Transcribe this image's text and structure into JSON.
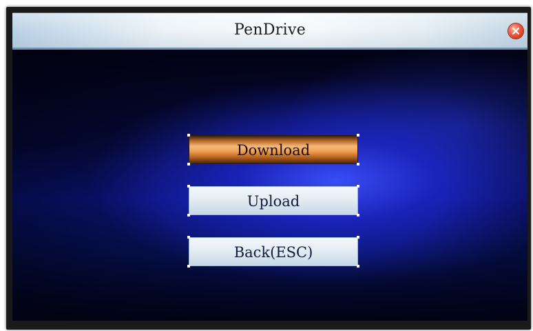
{
  "window": {
    "title": "PenDrive",
    "close_icon": "close-icon",
    "close_color": "#e24a2c"
  },
  "menu": {
    "items": [
      {
        "label": "Download",
        "selected": true
      },
      {
        "label": "Upload",
        "selected": false
      },
      {
        "label": "Back(ESC)",
        "selected": false
      }
    ]
  },
  "colors": {
    "background": "#0a1270",
    "highlight": "#f2a257",
    "button": "#e6eef4"
  }
}
